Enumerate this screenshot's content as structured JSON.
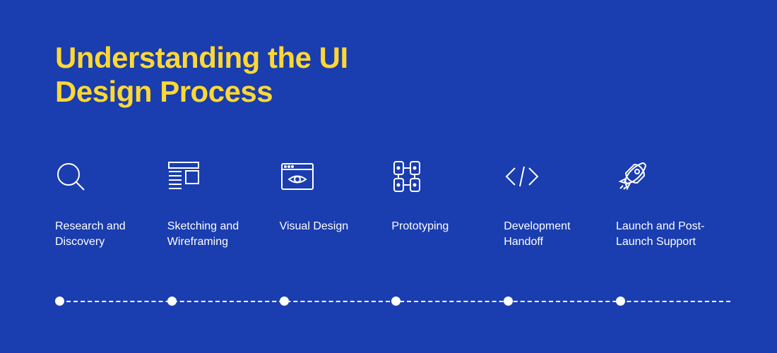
{
  "title_line1": "Understanding the UI",
  "title_line2": "Design Process",
  "colors": {
    "background": "#1A3DAF",
    "title": "#FDD835",
    "text": "#FFFFFF",
    "icon": "#FFFFFF"
  },
  "steps": [
    {
      "label": "Research and Discovery",
      "icon": "magnify"
    },
    {
      "label": "Sketching and Wireframing",
      "icon": "wireframe"
    },
    {
      "label": "Visual Design",
      "icon": "visual"
    },
    {
      "label": "Prototyping",
      "icon": "prototype"
    },
    {
      "label": "Development Handoff",
      "icon": "code"
    },
    {
      "label": "Launch and Post-Launch Support",
      "icon": "rocket"
    }
  ]
}
